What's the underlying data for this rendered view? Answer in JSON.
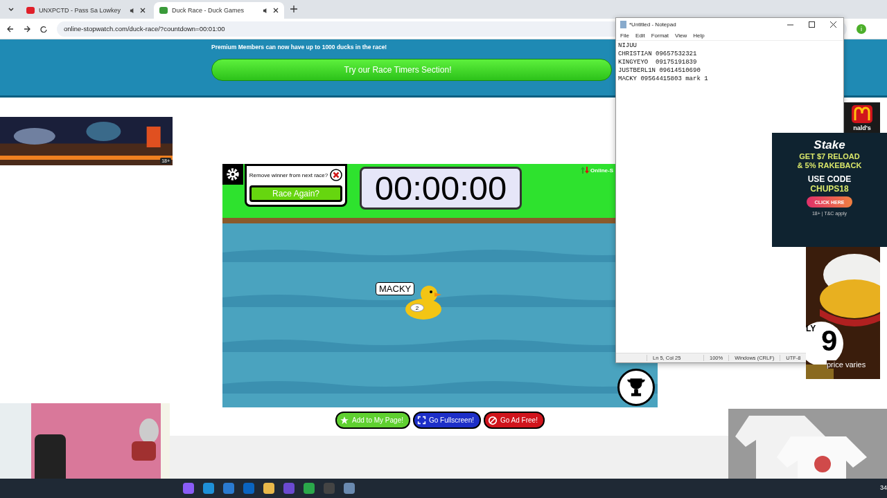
{
  "browser": {
    "tabs": [
      {
        "title": "UNXPCTD - Pass Sa Lowkey",
        "selected": false
      },
      {
        "title": "Duck Race - Duck Games",
        "selected": true
      }
    ],
    "url": "online-stopwatch.com/duck-race/?countdown=00:01:00",
    "avatar": "i"
  },
  "banner": {
    "notice": "Premium Members can now have up to 1000 ducks in the race!",
    "button": "Try our Race Timers Section!"
  },
  "side_ad": {
    "badge": "18+"
  },
  "game": {
    "prompt": "Remove winner from next race?",
    "race_again": "Race Again?",
    "timer": "00:00:00",
    "corner_label": "Online-S",
    "ducks": [
      {
        "name": "MACKY",
        "number": "2"
      }
    ]
  },
  "page_buttons": [
    {
      "kind": "add",
      "label": "Add to My Page!"
    },
    {
      "kind": "fullscreen",
      "label": "Go Fullscreen!"
    },
    {
      "kind": "adfree",
      "label": "Go Ad Free!"
    }
  ],
  "notepad": {
    "title": "*Untitled - Notepad",
    "menu": [
      "File",
      "Edit",
      "Format",
      "View",
      "Help"
    ],
    "lines": [
      "NIJUU",
      "CHRISTIAN 09657532321",
      "KINGYEYO  09175191839",
      "JUSTBERL1N 09614510690",
      "MACKY 09564415803 mark 1"
    ],
    "status": [
      "Ln 5, Col 25",
      "100%",
      "Windows (CRLF)",
      "UTF-8"
    ]
  },
  "stake_ad": {
    "logo": "Stake",
    "offer": [
      "GET $7 RELOAD",
      "& 5% RAKEBACK"
    ],
    "code_label": "USE CODE",
    "code": "CHUPS18",
    "button": "CLICK HERE",
    "fine_print": "18+ | T&C apply"
  },
  "food_ad": {
    "brand": "nald's",
    "price_prefix": "LY",
    "price": "9",
    "note": "price varies"
  },
  "taskbar": {
    "clock": "34"
  }
}
